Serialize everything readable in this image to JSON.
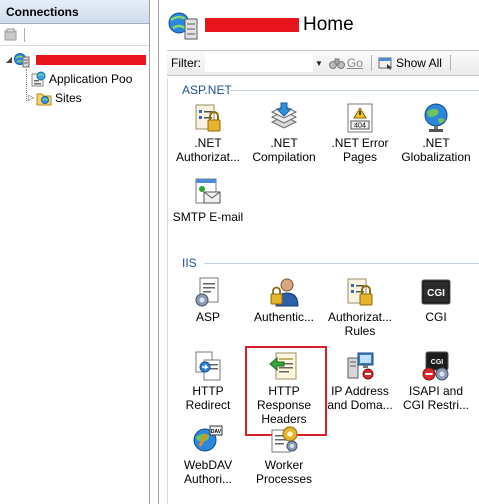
{
  "connections": {
    "title": "Connections",
    "tree": [
      {
        "label": "",
        "type": "server",
        "expander": "◢"
      },
      {
        "label": "Application Poo",
        "type": "app-pools"
      },
      {
        "label": "Sites",
        "type": "sites",
        "expander": "▷"
      }
    ]
  },
  "main": {
    "title": "Home",
    "filter": {
      "label": "Filter:",
      "value": "",
      "go_label": "Go",
      "show_all_label": "Show All"
    },
    "groups": [
      {
        "name": "ASP.NET",
        "features": [
          {
            "line1": ".NET",
            "line2": "Authorizat...",
            "icon": "net-authorization-icon"
          },
          {
            "line1": ".NET",
            "line2": "Compilation",
            "icon": "net-compilation-icon"
          },
          {
            "line1": ".NET Error",
            "line2": "Pages",
            "icon": "net-error-pages-icon"
          },
          {
            "line1": ".NET",
            "line2": "Globalization",
            "icon": "net-globalization-icon"
          },
          {
            "line1": "SMTP E-mail",
            "line2": "",
            "icon": "smtp-email-icon"
          }
        ]
      },
      {
        "name": "IIS",
        "features": [
          {
            "line1": "ASP",
            "line2": "",
            "icon": "asp-icon"
          },
          {
            "line1": "Authentic...",
            "line2": "",
            "icon": "authentication-icon"
          },
          {
            "line1": "Authorizat...",
            "line2": "Rules",
            "icon": "authorization-rules-icon"
          },
          {
            "line1": "CGI",
            "line2": "",
            "icon": "cgi-icon"
          },
          {
            "line1": "HTTP",
            "line2": "Redirect",
            "icon": "http-redirect-icon"
          },
          {
            "line1": "HTTP",
            "line2": "Response",
            "line3": "Headers",
            "icon": "http-response-headers-icon",
            "selected": true
          },
          {
            "line1": "IP Address",
            "line2": "and Doma...",
            "icon": "ip-address-icon"
          },
          {
            "line1": "ISAPI and",
            "line2": "CGI Restri...",
            "icon": "isapi-cgi-icon"
          },
          {
            "line1": "WebDAV",
            "line2": "Authori...",
            "icon": "webdav-icon"
          },
          {
            "line1": "Worker",
            "line2": "Processes",
            "icon": "worker-processes-icon"
          }
        ]
      }
    ]
  },
  "colors": {
    "group_header": "#1f4e96",
    "selection_border": "#d5202a",
    "redaction": "#e8141c"
  }
}
